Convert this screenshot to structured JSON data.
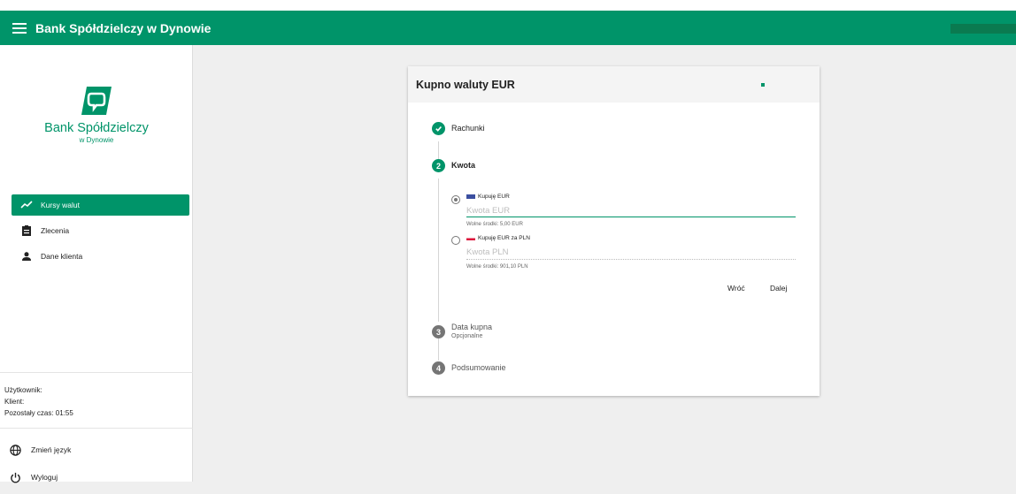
{
  "app": {
    "title": "Bank Spółdzielczy w Dynowie"
  },
  "logo": {
    "name": "Bank Spółdzielczy",
    "subtitle": "w Dynowie"
  },
  "sidebar": {
    "items": [
      {
        "label": "Kursy walut",
        "icon": "trending-up-icon",
        "active": true
      },
      {
        "label": "Zlecenia",
        "icon": "clipboard-icon",
        "active": false
      },
      {
        "label": "Dane klienta",
        "icon": "person-icon",
        "active": false
      }
    ],
    "session": {
      "user_label": "Użytkownik:",
      "client_label": "Klient:",
      "remaining_label": "Pozostały czas: 01:55"
    },
    "bottom_items": [
      {
        "label": "Zmień język",
        "icon": "globe-icon"
      },
      {
        "label": "Wyloguj",
        "icon": "power-icon"
      }
    ]
  },
  "card": {
    "title": "Kupno waluty EUR",
    "steps": [
      {
        "number": "",
        "label": "Rachunki",
        "state": "done"
      },
      {
        "number": "2",
        "label": "Kwota",
        "state": "active"
      },
      {
        "number": "3",
        "label": "Data kupna",
        "sublabel": "Opcjonalne",
        "state": "pending"
      },
      {
        "number": "4",
        "label": "Podsumowanie",
        "state": "pending"
      }
    ],
    "amount": {
      "option1": {
        "label": "Kupuję EUR",
        "placeholder": "Kwota EUR",
        "hint": "Wolne środki: 5,00 EUR",
        "selected": true
      },
      "option2": {
        "label": "Kupuję EUR za PLN",
        "placeholder": "Kwota PLN",
        "hint": "Wolne środki: 901,10 PLN",
        "selected": false
      }
    },
    "buttons": {
      "back": "Wróć",
      "next": "Dalej"
    }
  },
  "colors": {
    "brand": "#009469",
    "eu_flag": "#3b4fa0",
    "pl_flag": "#dc143c"
  }
}
